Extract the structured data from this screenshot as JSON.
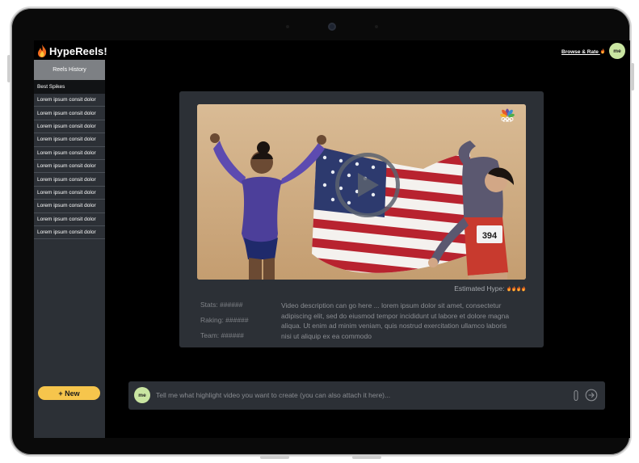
{
  "app": {
    "name": "HypeReels!"
  },
  "header": {
    "browse_label": "Browse & Rate",
    "browse_icon": "fire-icon",
    "avatar_label": "me"
  },
  "sidebar": {
    "history_title": "Reels History",
    "items": [
      {
        "label": "Best Spikes"
      },
      {
        "label": "Lorem ipsum consit dolor"
      },
      {
        "label": "Lorem ipsum consit dolor"
      },
      {
        "label": "Lorem ipsum consit dolor"
      },
      {
        "label": "Lorem ipsum consit dolor"
      },
      {
        "label": "Lorem ipsum consit dolor"
      },
      {
        "label": "Lorem ipsum consit dolor"
      },
      {
        "label": "Lorem ipsum consit dolor"
      },
      {
        "label": "Lorem ipsum consit dolor"
      },
      {
        "label": "Lorem ipsum consit dolor"
      },
      {
        "label": "Lorem ipsum consit dolor"
      },
      {
        "label": "Lorem ipsum consit dolor"
      }
    ],
    "new_button": "+ New"
  },
  "video": {
    "estimated_hype_label": "Estimated Hype:",
    "hype_level": 4,
    "hype_icon": "fire-icon",
    "stats": {
      "stats_line": "Stats:  ######",
      "raking_line": "Raking:  ######",
      "team_line": "Team:  ######"
    },
    "description": "Video description can go here ... lorem ipsum dolor sit amet, consectetur adipiscing elit, sed do eiusmod tempor incididunt ut labore et dolore magna aliqua. Ut enim ad minim veniam, quis nostrud exercitation ullamco laboris nisi ut aliquip ex ea commodo",
    "bib_number": "394"
  },
  "chat": {
    "avatar_label": "me",
    "placeholder": "Tell me what highlight video you want to create (you can also attach it here)..."
  },
  "colors": {
    "accent": "#f6c54c",
    "avatar": "#c9e5a1",
    "panel": "#2c3036",
    "background": "#000000"
  }
}
